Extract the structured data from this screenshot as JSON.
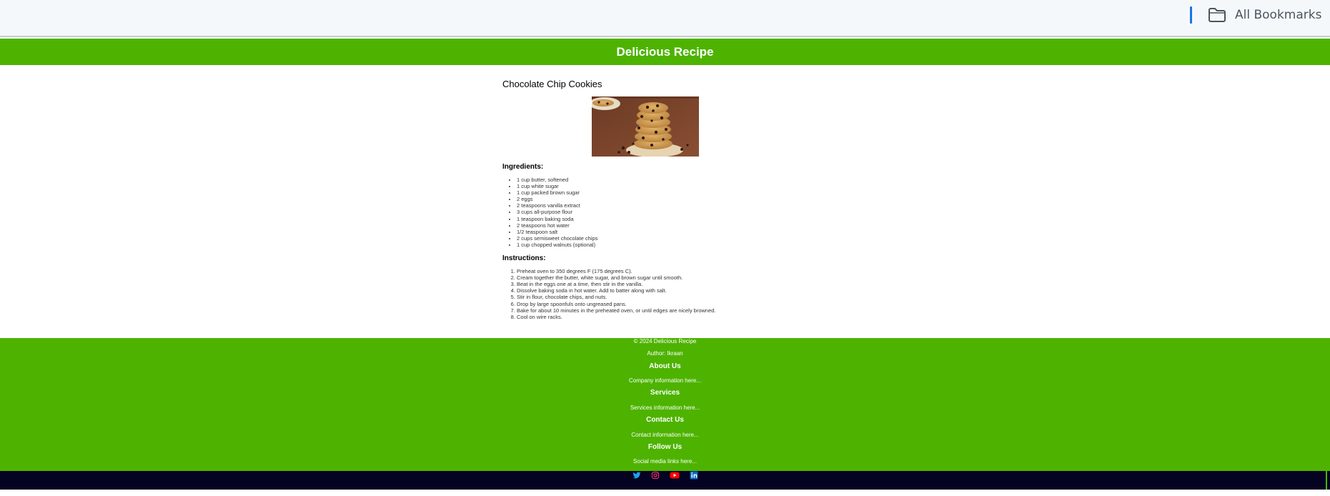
{
  "bookmarks": {
    "label": "All Bookmarks",
    "icon": "folder-icon",
    "accent": "#1a73e8"
  },
  "header": {
    "title": "Delicious Recipe",
    "color": "#4db300"
  },
  "recipe": {
    "title": "Chocolate Chip Cookies",
    "image_icon": "cookies-photo",
    "ingredients_heading": "Ingredients:",
    "ingredients": [
      "1 cup butter, softened",
      "1 cup white sugar",
      "1 cup packed brown sugar",
      "2 eggs",
      "2 teaspoons vanilla extract",
      "3 cups all-purpose flour",
      "1 teaspoon baking soda",
      "2 teaspoons hot water",
      "1/2 teaspoon salt",
      "2 cups semisweet chocolate chips",
      "1 cup chopped walnuts (optional)"
    ],
    "instructions_heading": "Instructions:",
    "instructions": [
      "Preheat oven to 350 degrees F (175 degrees C).",
      "Cream together the butter, white sugar, and brown sugar until smooth.",
      "Beat in the eggs one at a time, then stir in the vanilla.",
      "Dissolve baking soda in hot water. Add to batter along with salt.",
      "Stir in flour, chocolate chips, and nuts.",
      "Drop by large spoonfuls onto ungreased pans.",
      "Bake for about 10 minutes in the preheated oven, or until edges are nicely browned.",
      "Cool on wire racks."
    ]
  },
  "footer": {
    "copyright": "© 2024 Delicious Recipe",
    "author": "Author: Ikraan",
    "about_heading": "About Us",
    "about_text": "Company information here...",
    "services_heading": "Services",
    "services_text": "Services information here...",
    "contact_heading": "Contact Us",
    "contact_text": "Contact information here...",
    "follow_heading": "Follow Us",
    "follow_text": "Social media links here..."
  },
  "social": {
    "icons": [
      "twitter-icon",
      "instagram-icon",
      "youtube-icon",
      "linkedin-icon"
    ],
    "bar_color": "#050321"
  }
}
